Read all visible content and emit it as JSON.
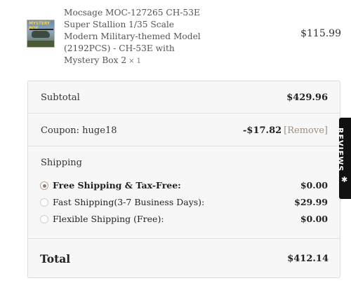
{
  "product": {
    "name_lines": [
      "Mocsage MOC-127265 CH-53E",
      "Super Stallion 1/35 Scale",
      "Modern Military-themed Model",
      "(2192PCS) - CH-53E with",
      "Mystery Box 2"
    ],
    "quantity": "× 1",
    "price": "$115.99",
    "thumb_label": "MYSTERY BOX"
  },
  "summary": {
    "subtotal_label": "Subtotal",
    "subtotal_value": "$429.96",
    "coupon_label": "Coupon: huge18",
    "coupon_value": "-$17.82",
    "coupon_remove": "[Remove]",
    "shipping_title": "Shipping",
    "shipping_options": [
      {
        "label": "Free Shipping & Tax-Free:",
        "price": "$0.00",
        "selected": true
      },
      {
        "label": "Fast Shipping(3-7 Business Days):",
        "price": "$29.99",
        "selected": false
      },
      {
        "label": "Flexible Shipping (Free):",
        "price": "$0.00",
        "selected": false
      }
    ],
    "total_label": "Total",
    "total_value": "$412.14"
  },
  "reviews_tab": {
    "label": "REVIEWS",
    "icon": "star-icon"
  },
  "colors": {
    "accent": "#9c7b66",
    "remove_link": "#a08d7d",
    "panel_bg": "#f7f7f7",
    "tab_bg": "#111111"
  }
}
